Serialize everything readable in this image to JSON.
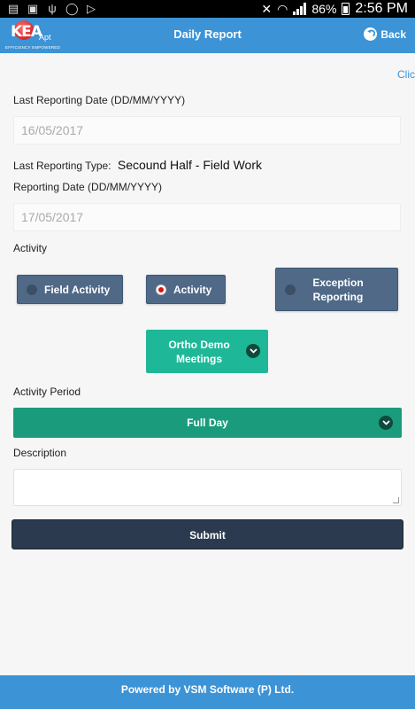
{
  "status_bar": {
    "battery": "86%",
    "time": "2:56 PM"
  },
  "header": {
    "logo_text": "KEA",
    "logo_sub": "Apt",
    "logo_tagline": "EFFICIENCY EMPOWERED",
    "title": "Daily Report",
    "back_label": "Back"
  },
  "clipped_link": "Clic",
  "form": {
    "last_date_label": "Last Reporting Date (DD/MM/YYYY)",
    "last_date_value": "16/05/2017",
    "last_type_label": "Last Reporting Type:",
    "last_type_value": "Secound Half - Field Work",
    "reporting_date_label": "Reporting Date (DD/MM/YYYY)",
    "reporting_date_value": "17/05/2017",
    "activity_label": "Activity",
    "activity_options": [
      {
        "label": "Field Activity",
        "selected": false
      },
      {
        "label": "Activity",
        "selected": true
      },
      {
        "label": "Exception Reporting",
        "selected": false
      }
    ],
    "activity_dropdown": "Ortho Demo Meetings",
    "period_label": "Activity Period",
    "period_value": "Full Day",
    "description_label": "Description",
    "description_value": "",
    "submit_label": "Submit"
  },
  "footer": {
    "text": "Powered by VSM Software (P) Ltd."
  },
  "colors": {
    "header_blue": "#3c93d6",
    "radio_button": "#4f6987",
    "teal": "#1eb898",
    "teal_dark": "#1a9c7c",
    "submit": "#2b3a4f"
  }
}
